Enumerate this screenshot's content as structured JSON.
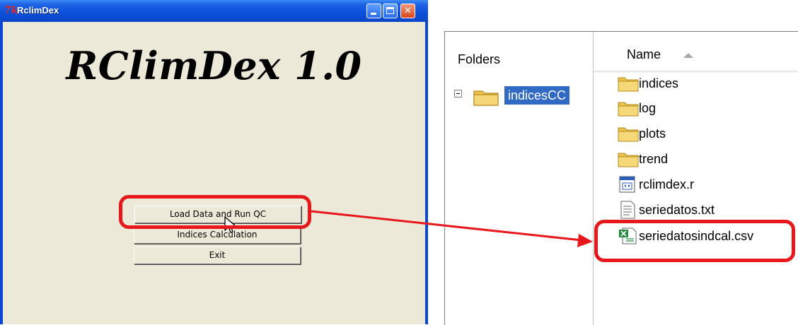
{
  "window": {
    "title": "RclimDex",
    "app_heading": "RClimDex 1.0",
    "buttons": {
      "load": "Load Data and Run QC",
      "indices": "Indices Calculation",
      "exit": "Exit"
    },
    "icons": {
      "app": "tk-feather-icon",
      "minimize": "minimize-icon",
      "maximize": "maximize-icon",
      "close": "close-icon"
    }
  },
  "explorer": {
    "folders_header": "Folders",
    "name_header": "Name",
    "tree": [
      {
        "label": "indicesCC",
        "expanded": true,
        "selected": true
      }
    ],
    "files": [
      {
        "name": "indices",
        "icon": "folder-icon"
      },
      {
        "name": "log",
        "icon": "folder-icon"
      },
      {
        "name": "plots",
        "icon": "folder-icon"
      },
      {
        "name": "trend",
        "icon": "folder-icon"
      },
      {
        "name": "rclimdex.r",
        "icon": "r-script-icon"
      },
      {
        "name": "seriedatos.txt",
        "icon": "text-file-icon"
      },
      {
        "name": "seriedatosindcal.csv",
        "icon": "csv-file-icon"
      }
    ]
  },
  "annotation_color": "#e8171c",
  "selection_color": "#316ac5"
}
